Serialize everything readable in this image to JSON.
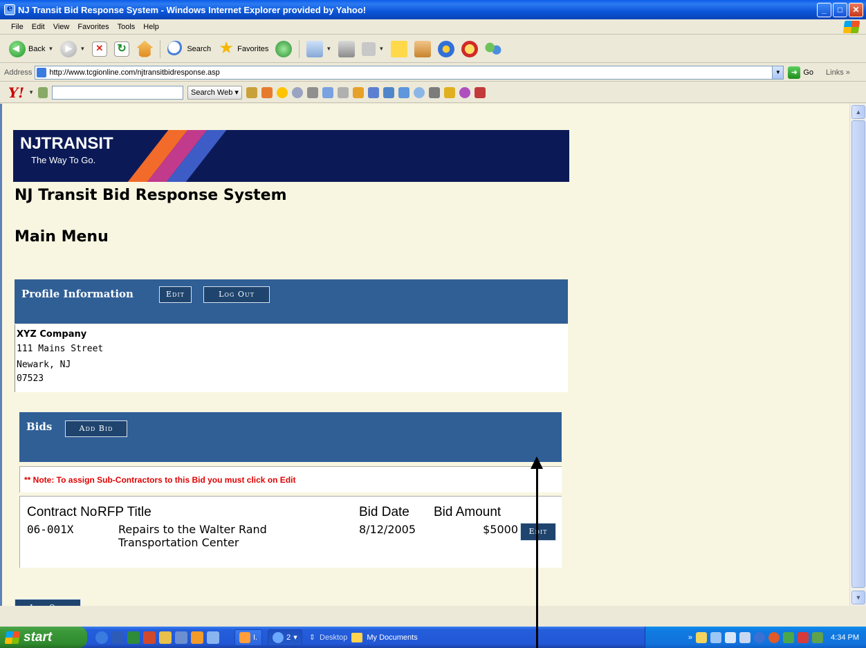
{
  "window": {
    "title": "NJ Transit Bid Response System - Windows Internet Explorer provided by Yahoo!"
  },
  "menu": [
    "File",
    "Edit",
    "View",
    "Favorites",
    "Tools",
    "Help"
  ],
  "toolbar": {
    "back_label": "Back",
    "search_label": "Search",
    "favorites_label": "Favorites"
  },
  "address": {
    "label": "Address",
    "url": "http://www.tcgionline.com/njtransitbidresponse.asp",
    "go_label": "Go",
    "links_label": "Links"
  },
  "yahoo": {
    "search_web_label": "Search Web"
  },
  "page": {
    "logo_text": "NJTRANSIT",
    "tagline": "The Way To Go.",
    "title": "NJ Transit Bid Response System",
    "subtitle": "Main Menu",
    "profile": {
      "header": "Profile Information",
      "edit_label": "Edit",
      "logout_label": "Log Out",
      "company": "XYZ Company",
      "street": "111 Mains Street",
      "city": "Newark, NJ",
      "zip": "07523"
    },
    "bids": {
      "header": "Bids",
      "add_bid_label": "Add Bid",
      "note": "** Note: To assign Sub-Contractors to this Bid you must click on Edit",
      "columns": [
        "Contract No",
        "RFP Title",
        "Bid Date",
        "Bid Amount"
      ],
      "rows": [
        {
          "contract_no": "06-001X",
          "rfp_title_line1": "Repairs to the Walter Rand",
          "rfp_title_line2": "Transportation Center",
          "bid_date": "8/12/2005",
          "bid_amount": "$5000",
          "edit_label": "Edit"
        }
      ]
    },
    "bottom_logout_label": "Log Out"
  },
  "taskbar": {
    "start_label": "start",
    "task1_label": "I.",
    "task2_label": "2",
    "desktop_label": "Desktop",
    "my_documents_label": "My Documents",
    "clock": "4:34 PM"
  }
}
